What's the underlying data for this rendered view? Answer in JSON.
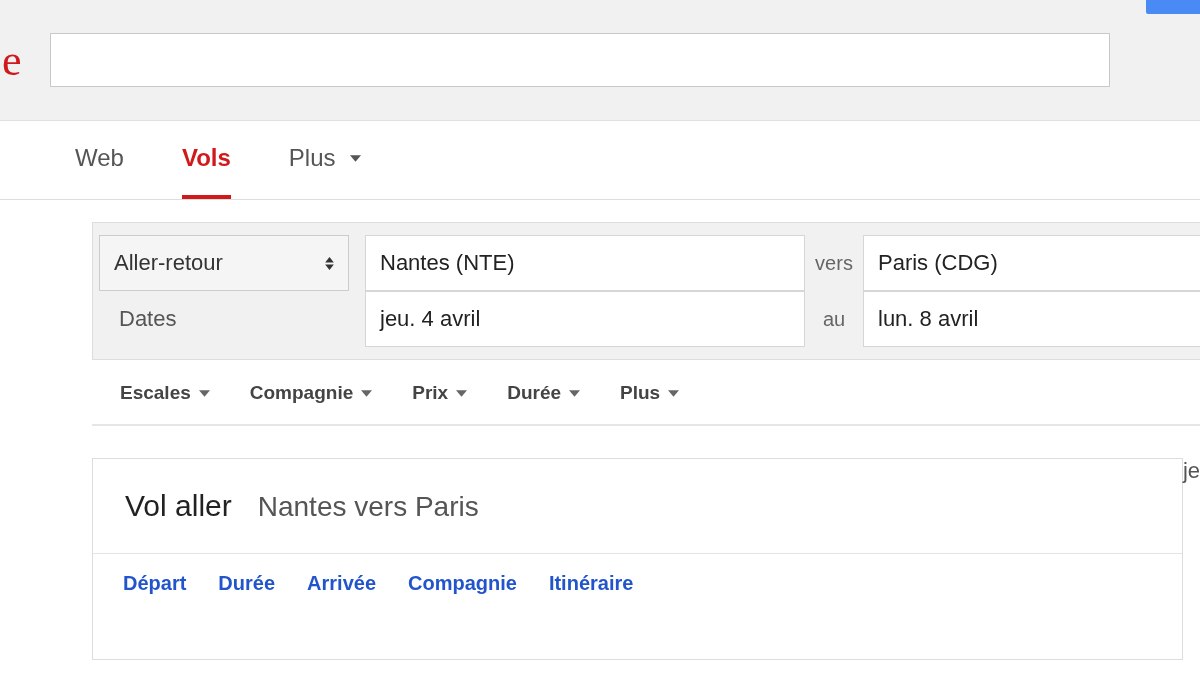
{
  "logo": {
    "text": "e"
  },
  "tabs": [
    {
      "label": "Web",
      "selected": false,
      "dropdown": false
    },
    {
      "label": "Vols",
      "selected": true,
      "dropdown": false
    },
    {
      "label": "Plus",
      "selected": false,
      "dropdown": true
    }
  ],
  "flight_form": {
    "trip_type": "Aller-retour",
    "origin": "Nantes (NTE)",
    "to_label": "vers",
    "destination": "Paris (CDG)",
    "dates_label": "Dates",
    "departure_date": "jeu. 4 avril",
    "until_label": "au",
    "return_date": "lun. 8 avril"
  },
  "filters": [
    "Escales",
    "Compagnie",
    "Prix",
    "Durée",
    "Plus"
  ],
  "side_text": "je",
  "results": {
    "title": "Vol aller",
    "subtitle": "Nantes vers Paris",
    "columns": [
      "Départ",
      "Durée",
      "Arrivée",
      "Compagnie",
      "Itinéraire"
    ]
  }
}
